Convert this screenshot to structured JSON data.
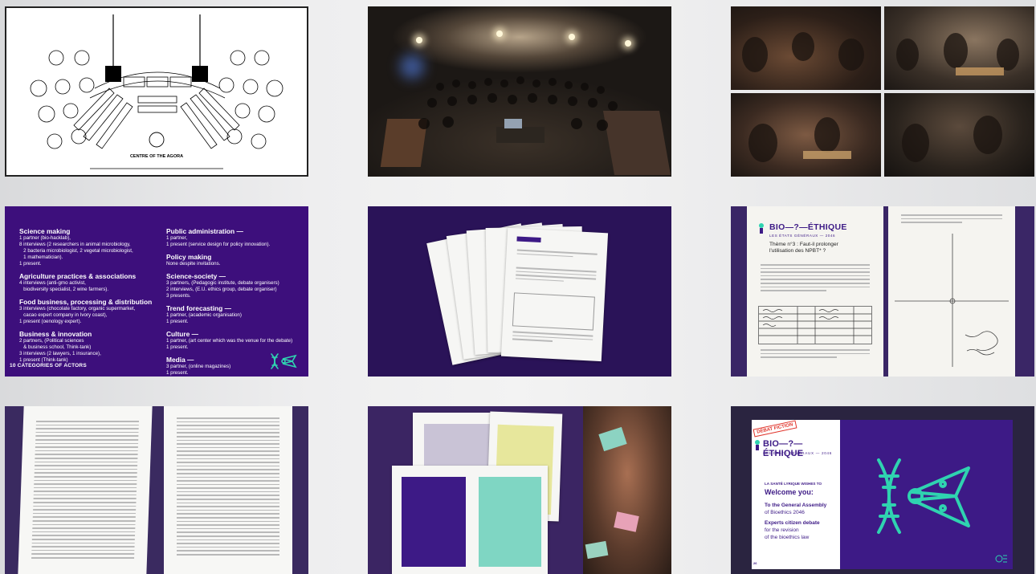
{
  "tile1": {
    "caption": "CENTRE OF THE AGORA"
  },
  "tile4": {
    "footer": "10 CATEGORIES OF ACTORS",
    "left": [
      {
        "title": "Science making",
        "lines": [
          "1 partner (bio-hacklab),",
          "8 interviews (2 researchers in animal microbiology,",
          "   2 bacteria microbiologist, 2 vegetal microbiologist,",
          "   1 mathematician).",
          "1 present."
        ]
      },
      {
        "title": "Agriculture practices & associations",
        "lines": [
          "4 interviews (anti-gmo activist,",
          "   biodiversity specialist, 2 wine farmers)."
        ]
      },
      {
        "title": "Food business, processing & distribution",
        "lines": [
          "3 interviews (chocolate factory, organic supermarket,",
          "   cacao expert company in Ivory coast),",
          "1 present (oenology expert)."
        ]
      },
      {
        "title": "Business & innovation",
        "lines": [
          "2 partners, (Political sciences",
          "   & business school, Think-tank)",
          "3 interviews (2 lawyers, 1 insurance),",
          "1 present (Think-tank)"
        ]
      }
    ],
    "right": [
      {
        "title": "Public administration —",
        "lines": [
          "1 partner,",
          "1 present (service design for policy innovation)."
        ]
      },
      {
        "title": "Policy making",
        "lines": [
          "None despite invitations."
        ]
      },
      {
        "title": "Science-society —",
        "lines": [
          "3 partners, (Pedagogic institute, debate organisers)",
          "2 interviews, (E.U. ethics group, debate organiser)",
          "3 presents."
        ]
      },
      {
        "title": "Trend forecasting —",
        "lines": [
          "1 partner, (academic organisation)",
          "1 present."
        ]
      },
      {
        "title": "Culture —",
        "lines": [
          "1 partner, (art center which was the venue for the debate)",
          "1 present."
        ]
      },
      {
        "title": "Media —",
        "lines": [
          "3 partner, (online magazines)",
          "1 present."
        ]
      }
    ]
  },
  "tile6": {
    "brand": "BIO—?—ÉTHIQUE",
    "subtitle": "LES ÉTATS GÉNÉRAUX — 2046",
    "theme": [
      "Thème n°3 : Faut-il prolonger",
      "l'utilisation des NPBT* ?"
    ]
  },
  "tile9": {
    "stamp": "DÉBAT FICTION",
    "brand": "BIO—?—ÉTHIQUE",
    "subtitle": "LES ÉTATS GÉNÉRAUX — 2046",
    "kicker": "LA SANTÉ LYRIQUE WISHES TO",
    "welcome": "Welcome you:",
    "to_assembly": "To the General Assembly",
    "of_bioethics": "of Bioethics 2046",
    "experts": "Experts citizen debate",
    "revision": "for the revision",
    "law": "of the bioethics law",
    "page_no": "26",
    "colors": {
      "purple": "#3d1a86",
      "teal": "#2fd3b0",
      "red": "#e0342b"
    }
  }
}
